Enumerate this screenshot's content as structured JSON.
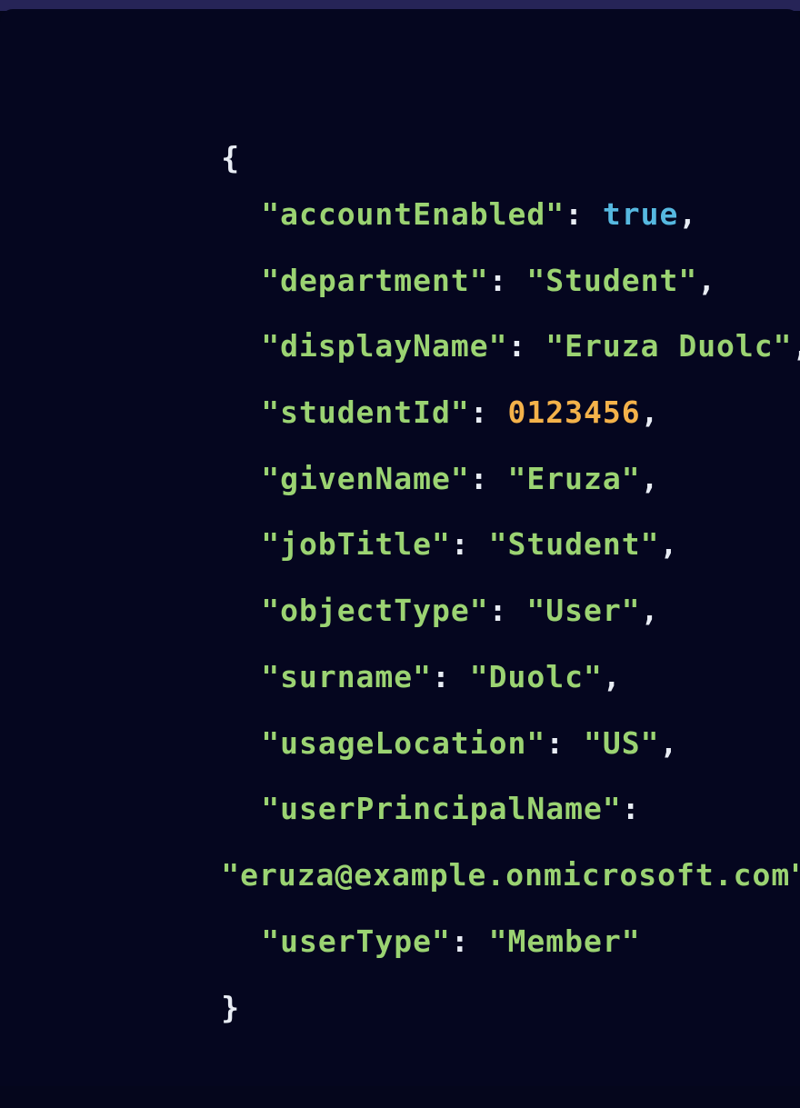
{
  "colors": {
    "background": "#05061f",
    "top_strip": "#262457",
    "key": "#9bd372",
    "string": "#9bd372",
    "boolean": "#56b8e0",
    "number": "#f4b24a",
    "punctuation": "#e8ecf4"
  },
  "code": {
    "open_brace": "{",
    "close_brace": "}",
    "lines": [
      {
        "key": "\"accountEnabled\"",
        "sep": ": ",
        "value": "true",
        "trail": ","
      },
      {
        "key": "\"department\"",
        "sep": ": ",
        "value": "\"Student\"",
        "trail": ","
      },
      {
        "key": "\"displayName\"",
        "sep": ": ",
        "value": "\"Eruza Duolc\"",
        "trail": ","
      },
      {
        "key": "\"studentId\"",
        "sep": ": ",
        "value": "0123456",
        "trail": ","
      },
      {
        "key": "\"givenName\"",
        "sep": ": ",
        "value": "\"Eruza\"",
        "trail": ","
      },
      {
        "key": "\"jobTitle\"",
        "sep": ": ",
        "value": "\"Student\"",
        "trail": ","
      },
      {
        "key": "\"objectType\"",
        "sep": ": ",
        "value": "\"User\"",
        "trail": ","
      },
      {
        "key": "\"surname\"",
        "sep": ": ",
        "value": "\"Duolc\"",
        "trail": ","
      },
      {
        "key": "\"usageLocation\"",
        "sep": ": ",
        "value": "\"US\"",
        "trail": ","
      },
      {
        "key": "\"userPrincipalName\"",
        "sep": ":",
        "value": "",
        "trail": ""
      },
      {
        "key": "",
        "sep": "",
        "value": "\"eruza@example.onmicrosoft.com\"",
        "trail": ","
      },
      {
        "key": "\"userType\"",
        "sep": ": ",
        "value": "\"Member\"",
        "trail": ""
      }
    ]
  }
}
